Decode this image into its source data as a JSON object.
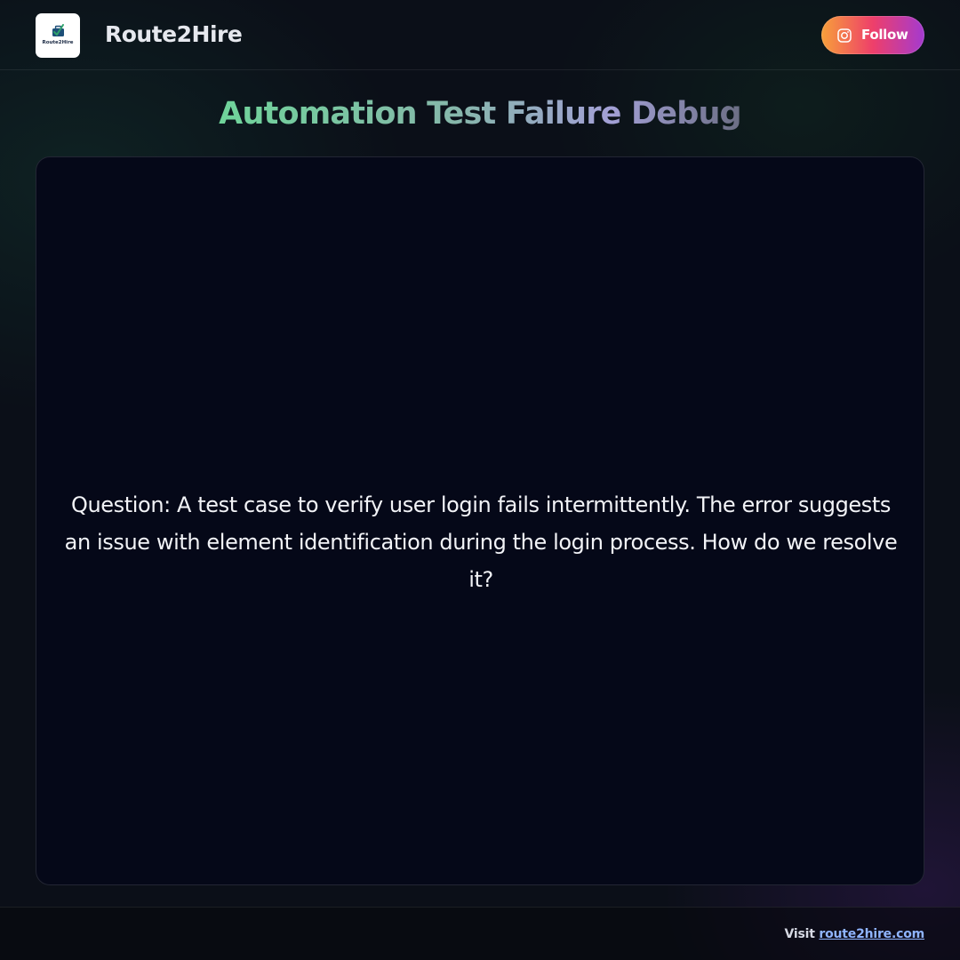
{
  "header": {
    "logo_text": "Route2Hire",
    "brand": "Route2Hire",
    "follow_label": "Follow"
  },
  "main": {
    "title": "Automation Test Failure Debug",
    "question": "Question: A test case to verify user login fails intermittently. The error suggests an issue with element identification during the login process. How do we resolve it?"
  },
  "footer": {
    "visit_prefix": "Visit",
    "link_text": "route2hire.com"
  },
  "icons": {
    "logo": "briefcase-check-icon",
    "follow": "instagram-icon"
  },
  "colors": {
    "follow_gradient": [
      "#f7a03a",
      "#ee3f6a",
      "#a43ad0"
    ],
    "link": "#8fb4ff"
  }
}
